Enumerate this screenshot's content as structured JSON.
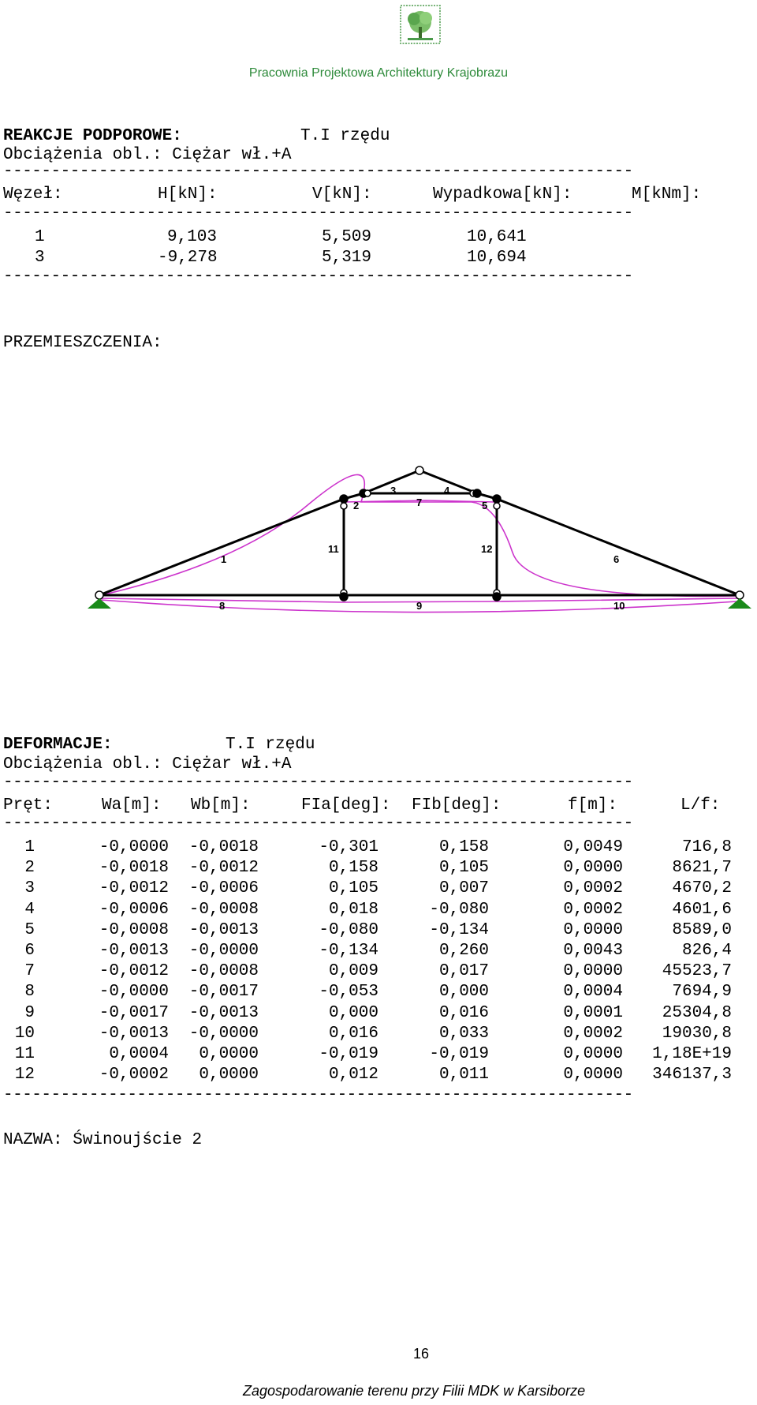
{
  "header": {
    "office_name": "Pracownia Projektowa Architektury Krajobrazu"
  },
  "reactions": {
    "title": "REAKCJE PODPOROWE:",
    "order": "T.I rzędu",
    "load_case": "Obciążenia obl.: Ciężar wł.+A",
    "separator": "------------------------------------------------------------------",
    "columns": [
      "Węzeł:",
      "H[kN]:",
      "V[kN]:",
      "Wypadkowa[kN]:",
      "M[kNm]:"
    ],
    "rows": [
      [
        "1",
        "9,103",
        "5,509",
        "10,641"
      ],
      [
        "3",
        "-9,278",
        "5,319",
        "10,694"
      ]
    ]
  },
  "displacements": {
    "title": "PRZEMIESZCZENIA:"
  },
  "truss": {
    "member_labels": [
      "1",
      "2",
      "3",
      "4",
      "5",
      "6",
      "7",
      "8",
      "9",
      "10",
      "11",
      "12"
    ],
    "colors": {
      "structure": "#000000",
      "deformed": "#cc33cc",
      "support": "#1a8a1a"
    }
  },
  "deformations": {
    "title": "DEFORMACJE:",
    "order": "T.I rzędu",
    "load_case": "Obciążenia obl.: Ciężar wł.+A",
    "separator": "------------------------------------------------------------------",
    "columns": [
      "Pręt:",
      "Wa[m]:",
      "Wb[m]:",
      "FIa[deg]:",
      "FIb[deg]:",
      "f[m]:",
      "L/f:"
    ],
    "rows": [
      [
        "1",
        "-0,0000",
        "-0,0018",
        "-0,301",
        "0,158",
        "0,0049",
        "716,8"
      ],
      [
        "2",
        "-0,0018",
        "-0,0012",
        "0,158",
        "0,105",
        "0,0000",
        "8621,7"
      ],
      [
        "3",
        "-0,0012",
        "-0,0006",
        "0,105",
        "0,007",
        "0,0002",
        "4670,2"
      ],
      [
        "4",
        "-0,0006",
        "-0,0008",
        "0,018",
        "-0,080",
        "0,0002",
        "4601,6"
      ],
      [
        "5",
        "-0,0008",
        "-0,0013",
        "-0,080",
        "-0,134",
        "0,0000",
        "8589,0"
      ],
      [
        "6",
        "-0,0013",
        "-0,0000",
        "-0,134",
        "0,260",
        "0,0043",
        "826,4"
      ],
      [
        "7",
        "-0,0012",
        "-0,0008",
        "0,009",
        "0,017",
        "0,0000",
        "45523,7"
      ],
      [
        "8",
        "-0,0000",
        "-0,0017",
        "-0,053",
        "0,000",
        "0,0004",
        "7694,9"
      ],
      [
        "9",
        "-0,0017",
        "-0,0013",
        "0,000",
        "0,016",
        "0,0001",
        "25304,8"
      ],
      [
        "10",
        "-0,0013",
        "-0,0000",
        "0,016",
        "0,033",
        "0,0002",
        "19030,8"
      ],
      [
        "11",
        "0,0004",
        "0,0000",
        "-0,019",
        "-0,019",
        "0,0000",
        "1,18E+19"
      ],
      [
        "12",
        "-0,0002",
        "0,0000",
        "0,012",
        "0,011",
        "0,0000",
        "346137,3"
      ]
    ]
  },
  "name_line": "NAZWA: Świnoujście 2",
  "page_number": "16",
  "footer": "Zagospodarowanie terenu przy Filii MDK w Karsiborze"
}
